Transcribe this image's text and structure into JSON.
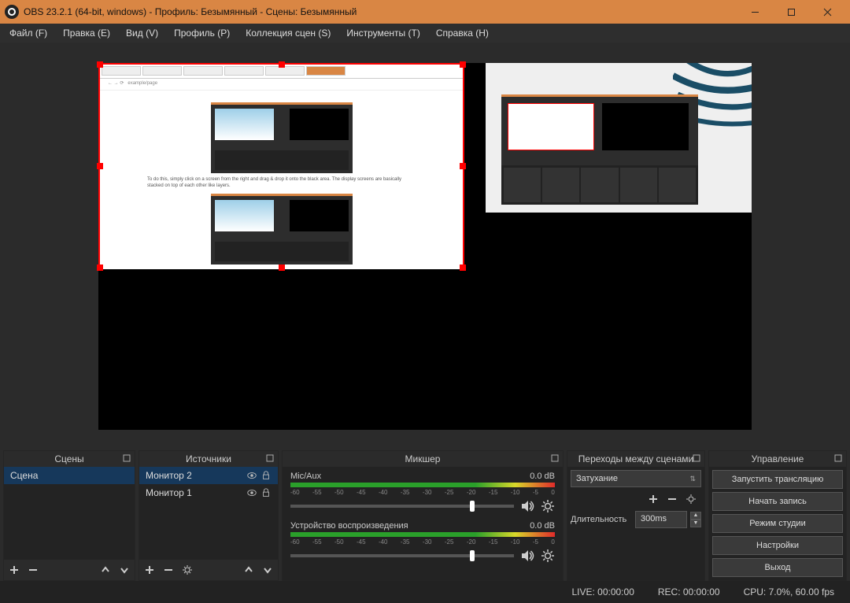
{
  "titlebar": {
    "title": "OBS 23.2.1 (64-bit, windows) - Профиль: Безымянный - Сцены: Безымянный"
  },
  "menu": {
    "file": "Файл (F)",
    "edit": "Правка (E)",
    "view": "Вид (V)",
    "profile": "Профиль (P)",
    "scenes": "Коллекция сцен (S)",
    "tools": "Инструменты (T)",
    "help": "Справка (H)"
  },
  "panels": {
    "scenes_title": "Сцены",
    "sources_title": "Источники",
    "mixer_title": "Микшер",
    "transitions_title": "Переходы между сценами",
    "controls_title": "Управление"
  },
  "scenes": {
    "items": [
      {
        "label": "Сцена"
      }
    ]
  },
  "sources": {
    "items": [
      {
        "label": "Монитор 2"
      },
      {
        "label": "Монитор 1"
      }
    ]
  },
  "mixer": {
    "ticks": [
      "-60",
      "-55",
      "-50",
      "-45",
      "-40",
      "-35",
      "-30",
      "-25",
      "-20",
      "-15",
      "-10",
      "-5",
      "0"
    ],
    "channels": [
      {
        "name": "Mic/Aux",
        "level": "0.0 dB"
      },
      {
        "name": "Устройство воспроизведения",
        "level": "0.0 dB"
      }
    ]
  },
  "transitions": {
    "selected": "Затухание",
    "duration_label": "Длительность",
    "duration_value": "300ms"
  },
  "controls": {
    "stream": "Запустить трансляцию",
    "record": "Начать запись",
    "studio": "Режим студии",
    "settings": "Настройки",
    "exit": "Выход"
  },
  "status": {
    "live": "LIVE: 00:00:00",
    "rec": "REC: 00:00:00",
    "cpu": "CPU: 7.0%, 60.00 fps"
  }
}
